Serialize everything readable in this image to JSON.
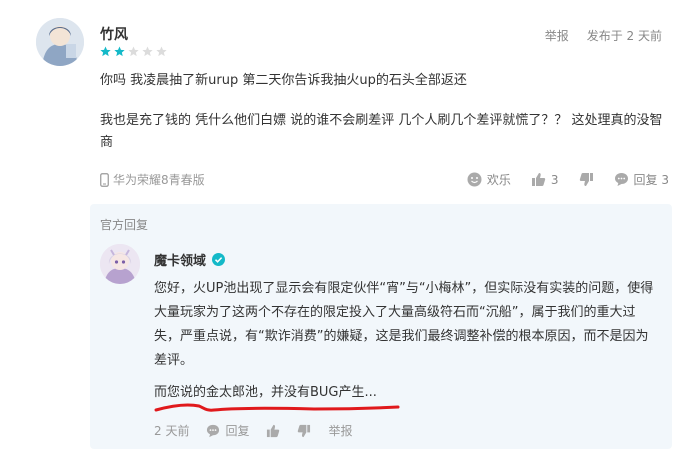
{
  "review": {
    "username": "竹风",
    "rating": 2,
    "rating_max": 5,
    "report_label": "举报",
    "posted": "发布于 2 天前",
    "paragraph1": "你吗 我凌晨抽了新urup 第二天你告诉我抽火up的石头全部返还",
    "paragraph2": "我也是充了钱的 凭什么他们白嫖 说的谁不会刷差评 几个人刷几个差评就慌了？？ 这处理真的没智商",
    "device": "华为荣耀8青春版",
    "fun_label": "欢乐",
    "like_count": "3",
    "reply_label": "回复 3"
  },
  "official": {
    "label": "官方回复",
    "name": "魔卡领域",
    "text": "您好，火UP池出现了显示会有限定伙伴“宵”与“小梅林”，但实际没有实装的问题，使得大量玩家为了这两个不存在的限定投入了大量高级符石而“沉船”，属于我们的重大过失，严重点说，有“欺诈消费”的嫌疑，这是我们最终调整补偿的根本原因，而不是因为差评。",
    "text2": "而您说的金太郎池，并没有BUG产生...",
    "time": "2 天前",
    "reply_label": "回复",
    "report_label": "举报"
  },
  "colors": {
    "star_active": "#14b9c8",
    "star_inactive": "#dcdcdc",
    "box_bg": "#f2f7fb",
    "annotation_red": "#e0191c",
    "verify_teal": "#14b9c8"
  }
}
